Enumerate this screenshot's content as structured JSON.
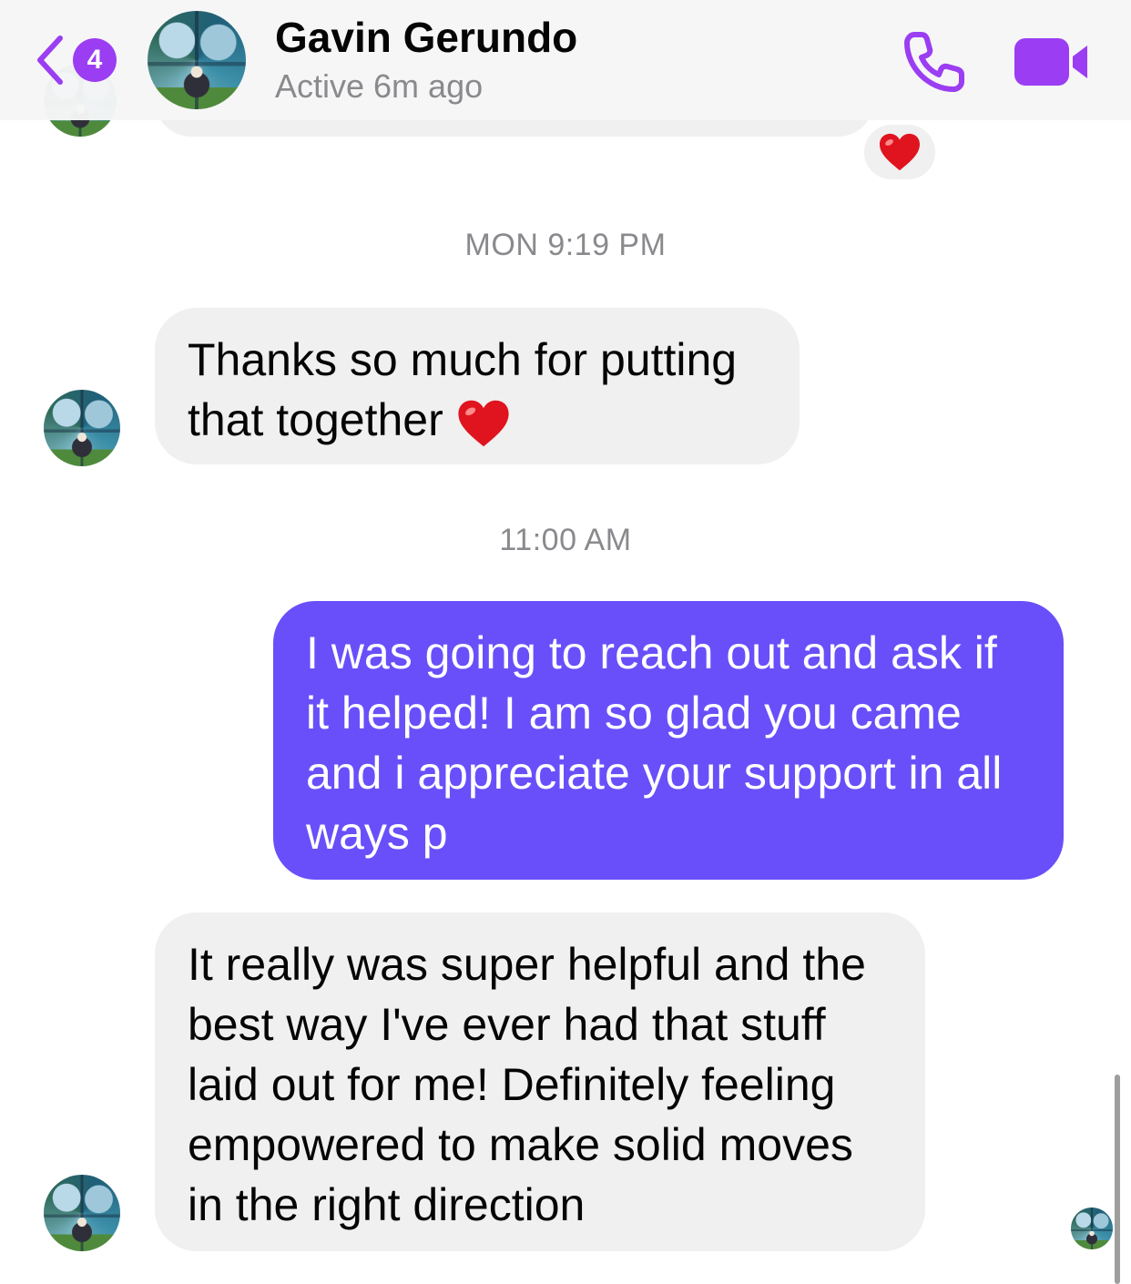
{
  "header": {
    "unread_count": "4",
    "contact_name": "Gavin Gerundo",
    "contact_status": "Active 6m ago",
    "accent_color": "#9b3df2"
  },
  "messages": {
    "timestamp_1": "MON 9:19 PM",
    "msg1": {
      "line1": "Thanks so much for putting",
      "line2": "that together",
      "emoji": "red-heart"
    },
    "timestamp_2": "11:00 AM",
    "msg2": {
      "line1": "I was going to reach out and ask if",
      "line2": "it helped! I am so glad you came",
      "line3": "and i appreciate your support in all",
      "line4": "ways p"
    },
    "msg3": {
      "line1": "It really was super helpful and the",
      "line2": "best way I've ever had that stuff",
      "line3": "laid out for me! Definitely feeling",
      "line4": "empowered to make solid moves",
      "line5": "in the right direction"
    },
    "reaction": "red-heart"
  },
  "colors": {
    "outgoing_bubble": "#694ffa",
    "incoming_bubble": "#f0f0f0"
  }
}
